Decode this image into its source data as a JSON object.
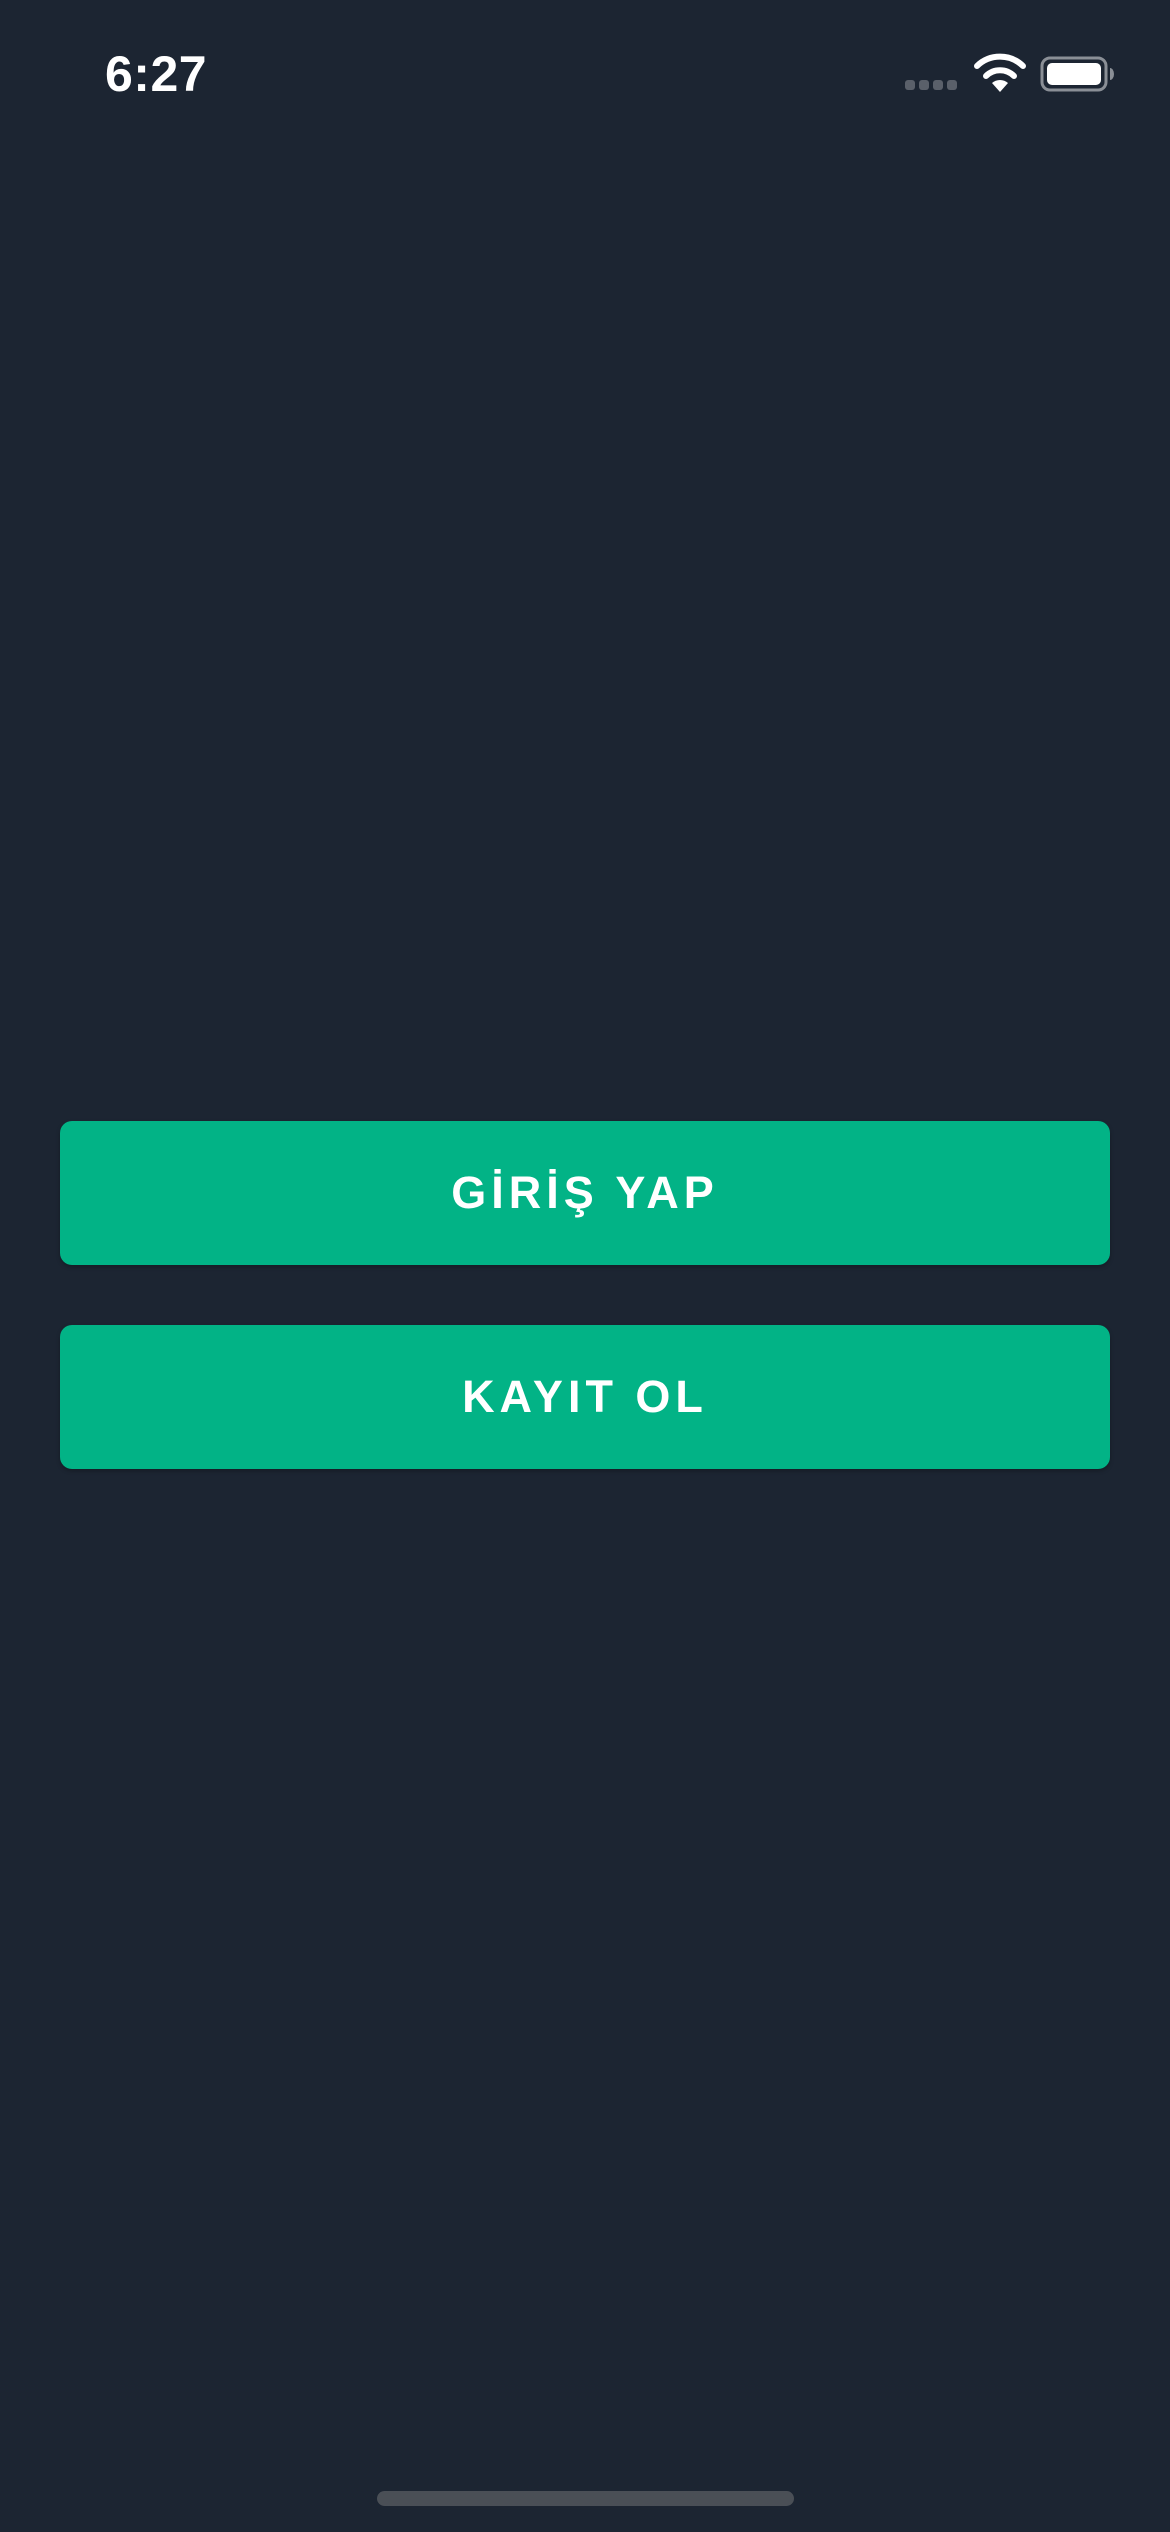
{
  "status_bar": {
    "time": "6:27",
    "icons": [
      "signal-icon",
      "wifi-icon",
      "battery-icon"
    ]
  },
  "auth_screen": {
    "login_label": "GİRİŞ YAP",
    "register_label": "KAYIT OL"
  },
  "colors": {
    "background": "#1c2532",
    "accent": "#02b386",
    "text": "#ffffff"
  }
}
